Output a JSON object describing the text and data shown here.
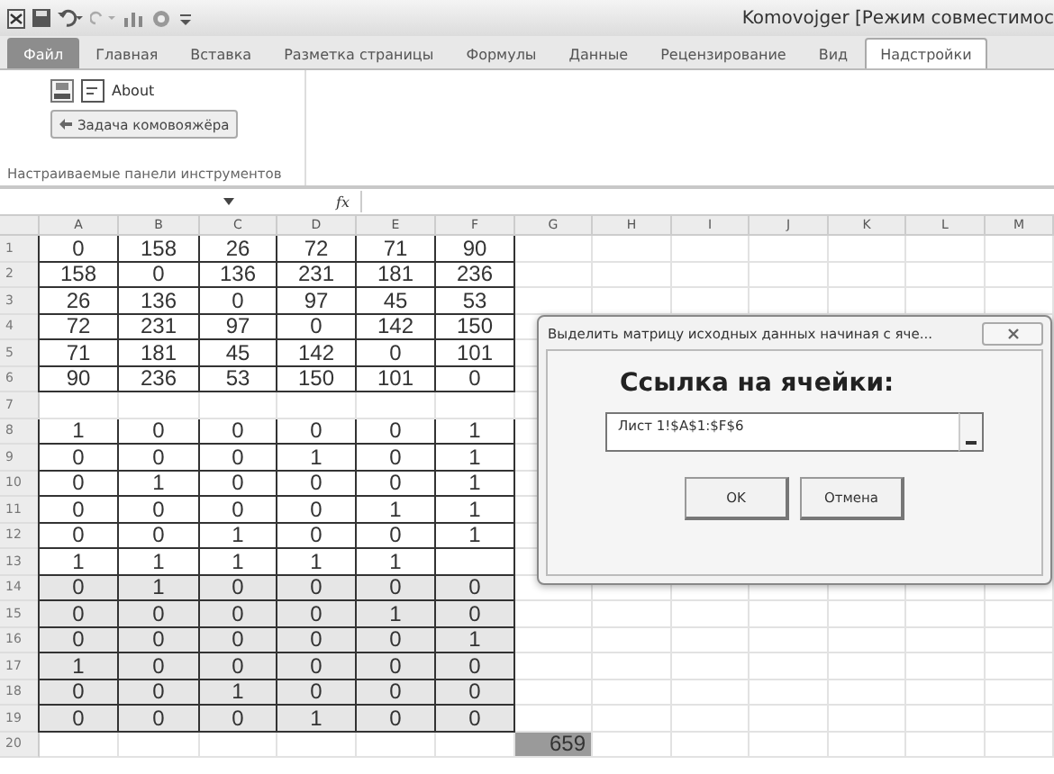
{
  "window": {
    "title": "Komovojger  [Режим совместимос"
  },
  "tabs": [
    {
      "label": "Файл",
      "kind": "file",
      "selected": false
    },
    {
      "label": "Главная",
      "kind": "tab",
      "selected": false
    },
    {
      "label": "Вставка",
      "kind": "tab",
      "selected": false
    },
    {
      "label": "Разметка страницы",
      "kind": "tab",
      "selected": false
    },
    {
      "label": "Формулы",
      "kind": "tab",
      "selected": false
    },
    {
      "label": "Данные",
      "kind": "tab",
      "selected": false
    },
    {
      "label": "Рецензирование",
      "kind": "tab",
      "selected": false
    },
    {
      "label": "Вид",
      "kind": "tab",
      "selected": false
    },
    {
      "label": "Надстройки",
      "kind": "tab",
      "selected": true
    }
  ],
  "ribbon": {
    "about": "About",
    "task_button": "Задача комовояжёра",
    "group_label": "Настраиваемые панели инструментов"
  },
  "formula_bar": {
    "fx": "fx"
  },
  "columns": [
    "A",
    "B",
    "C",
    "D",
    "E",
    "F",
    "G",
    "H",
    "I",
    "J",
    "K",
    "L",
    "M"
  ],
  "rows": [
    {
      "number": "1",
      "cells": [
        "0",
        "158",
        "26",
        "72",
        "71",
        "90"
      ],
      "shaded": false
    },
    {
      "number": "2",
      "cells": [
        "158",
        "0",
        "136",
        "231",
        "181",
        "236"
      ],
      "shaded": false
    },
    {
      "number": "3",
      "cells": [
        "26",
        "136",
        "0",
        "97",
        "45",
        "53"
      ],
      "shaded": false
    },
    {
      "number": "4",
      "cells": [
        "72",
        "231",
        "97",
        "0",
        "142",
        "150"
      ],
      "shaded": false
    },
    {
      "number": "5",
      "cells": [
        "71",
        "181",
        "45",
        "142",
        "0",
        "101"
      ],
      "shaded": false
    },
    {
      "number": "6",
      "cells": [
        "90",
        "236",
        "53",
        "150",
        "101",
        "0"
      ],
      "shaded": false
    },
    {
      "number": "7"
    },
    {
      "number": "8",
      "cells": [
        "1",
        "0",
        "0",
        "0",
        "0",
        "1"
      ],
      "shaded": false
    },
    {
      "number": "9",
      "cells": [
        "0",
        "0",
        "0",
        "1",
        "0",
        "1"
      ],
      "shaded": false
    },
    {
      "number": "10",
      "cells": [
        "0",
        "1",
        "0",
        "0",
        "0",
        "1"
      ],
      "shaded": false
    },
    {
      "number": "11",
      "cells": [
        "0",
        "0",
        "0",
        "0",
        "1",
        "1"
      ],
      "shaded": false
    },
    {
      "number": "12",
      "cells": [
        "0",
        "0",
        "1",
        "0",
        "0",
        "1"
      ],
      "shaded": false
    },
    {
      "number": "13",
      "cells": [
        "1",
        "1",
        "1",
        "1",
        "1"
      ],
      "shaded": false
    },
    {
      "number": "14",
      "cells": [
        "0",
        "1",
        "0",
        "0",
        "0",
        "0"
      ],
      "shaded": true
    },
    {
      "number": "15",
      "cells": [
        "0",
        "0",
        "0",
        "0",
        "1",
        "0"
      ],
      "shaded": true
    },
    {
      "number": "16",
      "cells": [
        "0",
        "0",
        "0",
        "0",
        "0",
        "1"
      ],
      "shaded": true
    },
    {
      "number": "17",
      "cells": [
        "1",
        "0",
        "0",
        "0",
        "0",
        "0"
      ],
      "shaded": true
    },
    {
      "number": "18",
      "cells": [
        "0",
        "0",
        "1",
        "0",
        "0",
        "0"
      ],
      "shaded": true
    },
    {
      "number": "19",
      "cells": [
        "0",
        "0",
        "0",
        "1",
        "0",
        "0"
      ],
      "shaded": true
    },
    {
      "number": "20",
      "total": "659"
    }
  ],
  "dialog": {
    "title": "Выделить матрицу исходных данных начиная с яче...",
    "heading": "Ссылка на ячейки:",
    "value": "Лист 1!$A$1:$F$6",
    "buttons": [
      "OK",
      "Отмена"
    ]
  }
}
